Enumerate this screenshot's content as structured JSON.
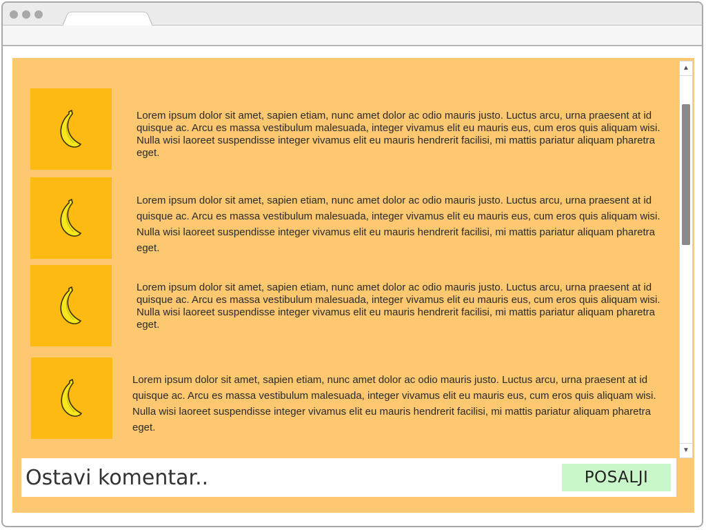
{
  "window": {
    "tab_title": ""
  },
  "feed": {
    "items": [
      {
        "icon": "banana-icon",
        "text": "Lorem ipsum dolor sit amet, sapien etiam, nunc amet dolor ac odio mauris justo. Luctus arcu, urna praesent at id quisque ac. Arcu es massa vestibulum malesuada, integer vivamus elit eu mauris eus, cum eros quis aliquam wisi. Nulla wisi laoreet suspendisse integer vivamus elit eu mauris hendrerit facilisi, mi mattis pariatur aliquam pharetra eget."
      },
      {
        "icon": "banana-icon",
        "text": "Lorem ipsum dolor sit amet, sapien etiam, nunc amet dolor ac odio mauris justo. Luctus arcu, urna praesent at id quisque ac. Arcu es massa vestibulum malesuada, integer vivamus elit eu mauris eus, cum eros quis aliquam wisi. Nulla wisi laoreet suspendisse integer vivamus elit eu mauris hendrerit facilisi, mi mattis pariatur aliquam pharetra eget."
      },
      {
        "icon": "banana-icon",
        "text": "Lorem ipsum dolor sit amet, sapien etiam, nunc amet dolor ac odio mauris justo. Luctus arcu, urna praesent at id quisque ac. Arcu es massa vestibulum malesuada, integer vivamus elit eu mauris eus, cum eros quis aliquam wisi. Nulla wisi laoreet suspendisse integer vivamus elit eu mauris hendrerit facilisi, mi mattis pariatur aliquam pharetra eget."
      },
      {
        "icon": "banana-icon",
        "text": "Lorem ipsum dolor sit amet, sapien etiam, nunc amet dolor ac odio mauris justo. Luctus arcu, urna praesent at id quisque ac. Arcu es massa vestibulum malesuada, integer vivamus elit eu mauris eus, cum eros quis aliquam wisi. Nulla wisi laoreet suspendisse integer vivamus elit eu mauris hendrerit facilisi, mi mattis pariatur aliquam pharetra eget."
      }
    ]
  },
  "comment": {
    "placeholder": "Ostavi komentar..",
    "value": "",
    "send_label": "POSALJI"
  },
  "colors": {
    "content_bg": "#fdc86f",
    "thumb_bg": "#fdba13",
    "send_button_bg": "#c9f7c9"
  }
}
